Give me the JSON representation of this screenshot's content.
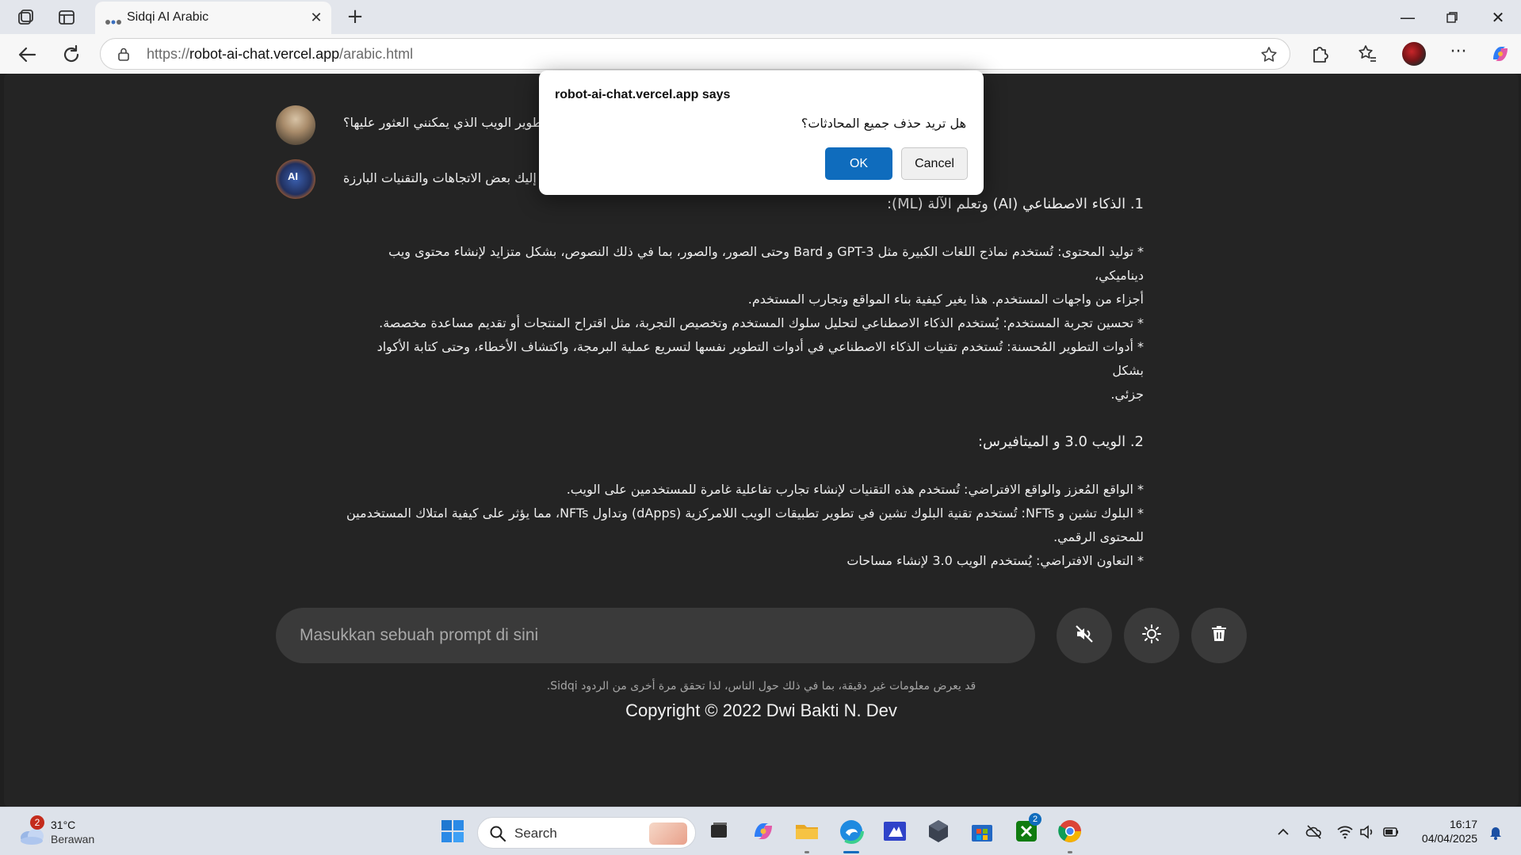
{
  "browser": {
    "tab_title": "Sidqi AI Arabic",
    "url_scheme": "https://",
    "url_host": "robot-ai-chat.vercel.app",
    "url_path": "/arabic.html"
  },
  "chat": {
    "user_message": "تطوير الويب الذي يمكنني العثور عليها؟",
    "bot_intro": "إليك بعض الاتجاهات والتقنيات البارزة",
    "bot_lines": [
      "1. الذكاء الاصطناعي (AI) وتعلم الآلة (ML):",
      "",
      "* توليد المحتوى: تُستخدم نماذج اللغات الكبيرة مثل GPT-3 و Bard وحتى الصور، والصور، بما في ذلك النصوص، بشكل متزايد لإنشاء محتوى ويب ديناميكي،",
      "أجزاء من واجهات المستخدم. هذا يغير كيفية بناء المواقع وتجارب المستخدم.",
      "* تحسين تجربة المستخدم: يُستخدم الذكاء الاصطناعي لتحليل سلوك المستخدم وتخصيص التجربة، مثل اقتراح المنتجات أو تقديم مساعدة مخصصة.",
      "* أدوات التطوير المُحسنة: تُستخدم تقنيات الذكاء الاصطناعي في أدوات التطوير نفسها لتسريع عملية البرمجة، واكتشاف الأخطاء، وحتى كتابة الأكواد بشكل",
      "جزئي.",
      "",
      "2. الويب 3.0 و الميتافيرس:",
      "",
      "* الواقع المُعزز والواقع الافتراضي: تُستخدم هذه التقنيات لإنشاء تجارب تفاعلية غامرة للمستخدمين على الويب.",
      "* البلوك تشين و NFTs: تُستخدم تقنية البلوك تشين في تطوير تطبيقات الويب اللامركزية (dApps) وتداول NFTs، مما يؤثر على كيفية امتلاك المستخدمين",
      "للمحتوى الرقمي.",
      "* التعاون الافتراضي: يُستخدم الويب 3.0 لإنشاء مساحات"
    ],
    "prompt_placeholder": "Masukkan sebuah prompt di sini",
    "disclaimer": "قد يعرض معلومات غير دقيقة، بما في ذلك حول الناس، لذا تحقق مرة أخرى من الردود Sidqi.",
    "copyright": "Copyright © 2022 Dwi Bakti N. Dev",
    "icons": [
      "mute-icon",
      "theme-toggle-icon",
      "trash-icon"
    ]
  },
  "dialog": {
    "title": "robot-ai-chat.vercel.app says",
    "message": "هل تريد حذف جميع المحادثات؟",
    "ok_label": "OK",
    "cancel_label": "Cancel",
    "accent": "#0f6cbd"
  },
  "taskbar": {
    "weather_temp": "31°C",
    "weather_desc": "Berawan",
    "weather_badge": "2",
    "search_label": "Search",
    "xbox_badge": "2",
    "time": "16:17",
    "date": "04/04/2025"
  }
}
